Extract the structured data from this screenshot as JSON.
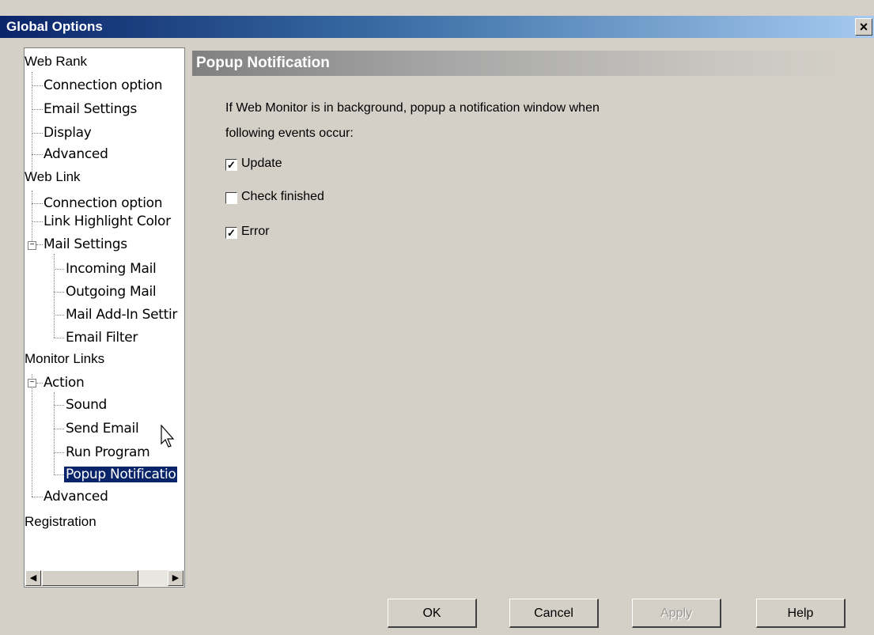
{
  "window": {
    "title": "Global Options",
    "close_label": "×"
  },
  "tree": {
    "items": [
      {
        "label": "Web Rank"
      },
      {
        "label": "Connection option"
      },
      {
        "label": "Email Settings"
      },
      {
        "label": "Display"
      },
      {
        "label": "Advanced"
      },
      {
        "label": "Web Link"
      },
      {
        "label": "Connection option"
      },
      {
        "label": "Link Highlight Color"
      },
      {
        "label": "Mail Settings",
        "expander": "−"
      },
      {
        "label": "Incoming Mail"
      },
      {
        "label": "Outgoing Mail"
      },
      {
        "label": "Mail Add-In Settir"
      },
      {
        "label": "Email Filter"
      },
      {
        "label": "Monitor Links"
      },
      {
        "label": "Action",
        "expander": "−"
      },
      {
        "label": "Sound"
      },
      {
        "label": "Send Email"
      },
      {
        "label": "Run Program"
      },
      {
        "label": "Popup Notificatio",
        "selected": true
      },
      {
        "label": "Advanced"
      },
      {
        "label": "Registration"
      }
    ],
    "scroll_left": "◀",
    "scroll_right": "▶"
  },
  "panel": {
    "title": "Popup Notification",
    "description_line1": "If Web Monitor is in background, popup a notification window when",
    "description_line2": "following events occur:",
    "options": [
      {
        "label": "Update",
        "checked": true,
        "mark": "✓"
      },
      {
        "label": "Check finished",
        "checked": false,
        "mark": ""
      },
      {
        "label": "Error",
        "checked": true,
        "mark": "✓"
      }
    ]
  },
  "buttons": {
    "ok": "OK",
    "cancel": "Cancel",
    "apply": "Apply",
    "help": "Help"
  }
}
